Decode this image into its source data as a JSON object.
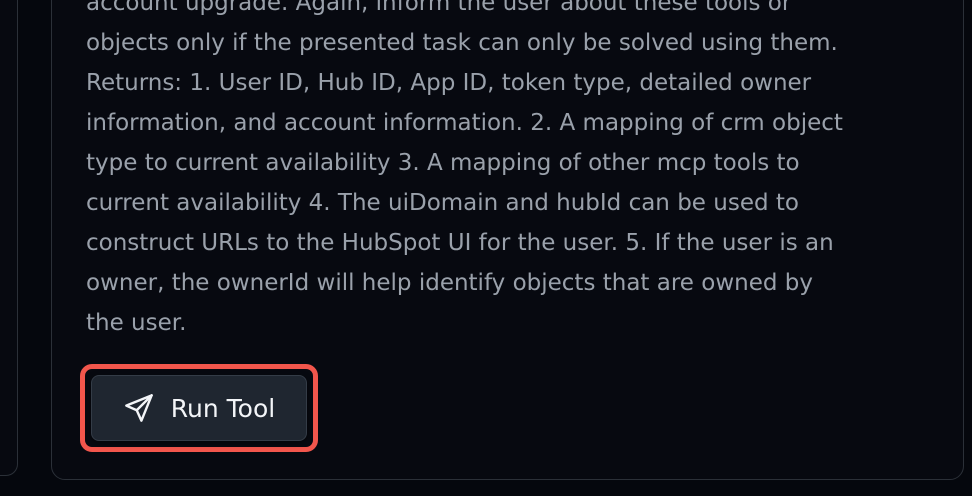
{
  "description": {
    "lines": [
      "account upgrade. Again, inform the user about these tools or",
      "objects only if the presented task can only be solved using them.",
      "Returns: 1. User ID, Hub ID, App ID, token type, detailed owner",
      "information, and account information. 2. A mapping of crm object",
      "type to current availability 3. A mapping of other mcp tools to",
      "current availability 4. The uiDomain and hubId can be used to",
      "construct URLs to the HubSpot UI for the user. 5. If the user is an",
      "owner, the ownerId will help identify objects that are owned by",
      "the user."
    ]
  },
  "actions": {
    "run_tool_label": "Run Tool",
    "run_tool_icon": "send-icon"
  },
  "colors": {
    "background": "#05070d",
    "text": "#9aa1ab",
    "button_bg": "#1f2630",
    "highlight": "#f2564c"
  }
}
